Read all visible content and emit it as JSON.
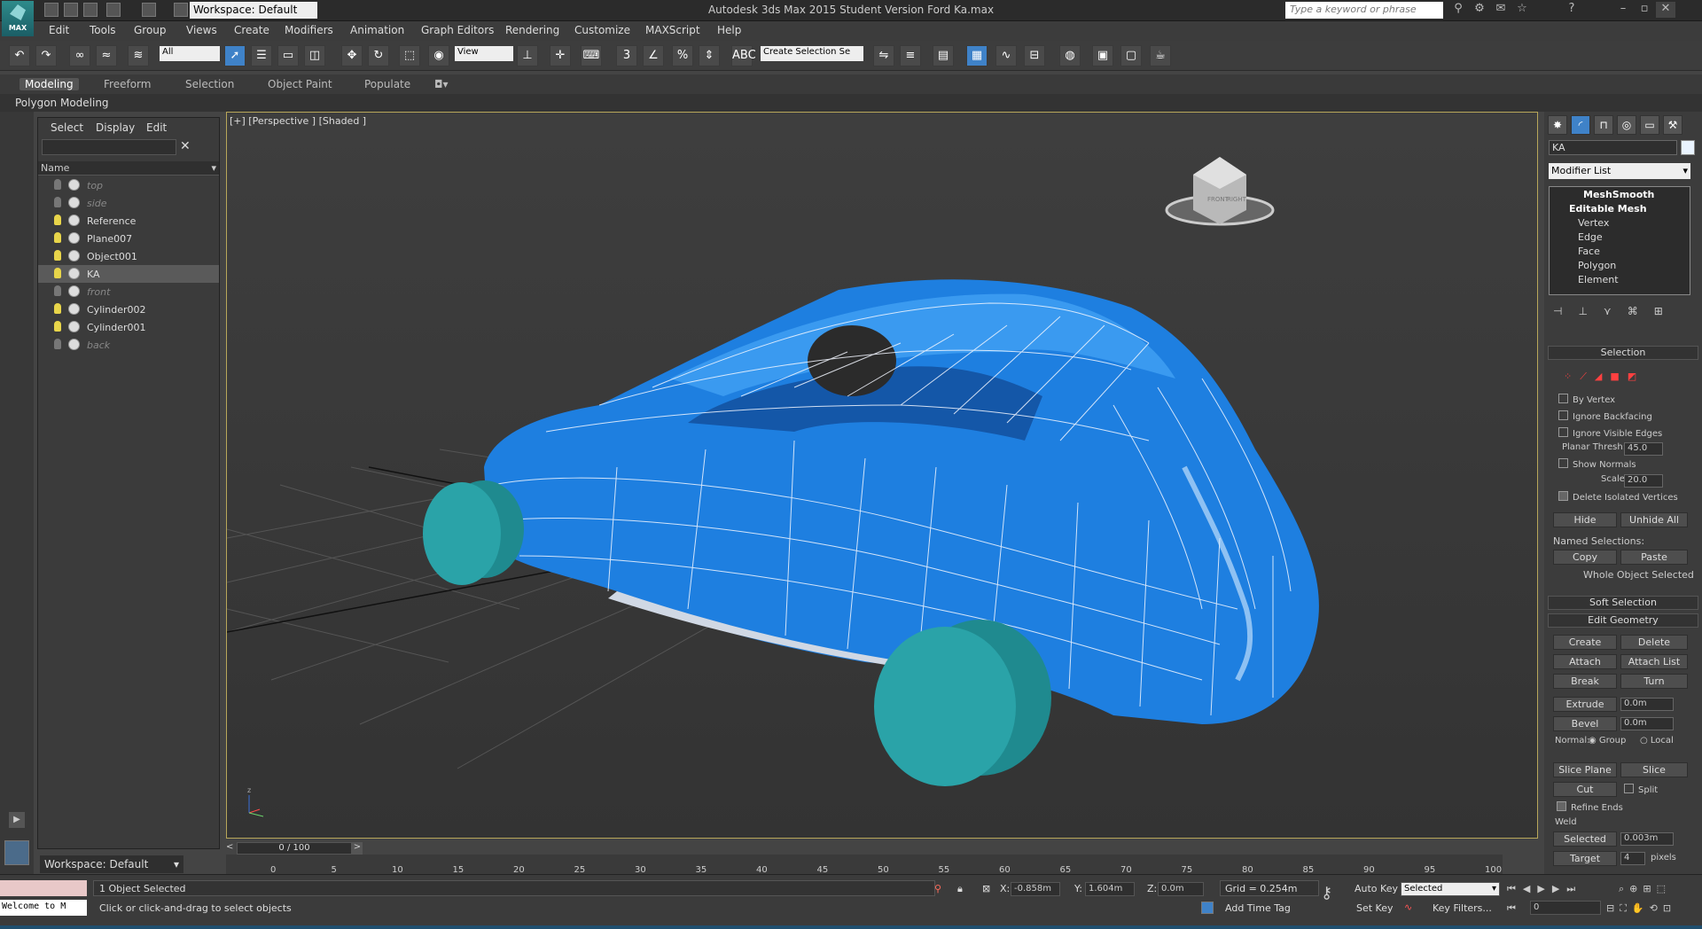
{
  "app": {
    "title": "Autodesk 3ds Max  2015    Student Version    Ford Ka.max",
    "logo_text": "MAX",
    "workspace": "Workspace: Default",
    "search_placeholder": "Type a keyword or phrase"
  },
  "menu": [
    "Edit",
    "Tools",
    "Group",
    "Views",
    "Create",
    "Modifiers",
    "Animation",
    "Graph Editors",
    "Rendering",
    "Customize",
    "MAXScript",
    "Help"
  ],
  "toolbar": {
    "filter": "All",
    "coord": "View",
    "selset": "Create Selection Se",
    "snap_num": "3",
    "angle_num": "%"
  },
  "ribbon": {
    "tabs": [
      "Modeling",
      "Freeform",
      "Selection",
      "Object Paint",
      "Populate"
    ],
    "active": "Modeling",
    "sub": "Polygon Modeling"
  },
  "scene": {
    "tabs": [
      "Select",
      "Display",
      "Edit"
    ],
    "column": "Name",
    "items": [
      {
        "name": "top",
        "hidden": true
      },
      {
        "name": "side",
        "hidden": true
      },
      {
        "name": "Reference",
        "hidden": false
      },
      {
        "name": "Plane007",
        "hidden": false
      },
      {
        "name": "Object001",
        "hidden": false
      },
      {
        "name": "KA",
        "hidden": false,
        "selected": true
      },
      {
        "name": "front",
        "hidden": true
      },
      {
        "name": "Cylinder002",
        "hidden": false
      },
      {
        "name": "Cylinder001",
        "hidden": false
      },
      {
        "name": "back",
        "hidden": true
      }
    ],
    "workspace": "Workspace: Default"
  },
  "viewport": {
    "label": "[+] [Perspective ] [Shaded ]",
    "viewcube_front": "FRONT",
    "viewcube_right": "RIGHT",
    "axis_z": "z",
    "body_color": "#1e7fe0",
    "wheel_color": "#2aa3a8"
  },
  "command": {
    "object_name": "KA",
    "modifier_list": "Modifier List",
    "stack": [
      "MeshSmooth",
      "Editable Mesh",
      "Vertex",
      "Edge",
      "Face",
      "Polygon",
      "Element"
    ],
    "selection": {
      "title": "Selection",
      "by_vertex": "By Vertex",
      "ignore_backfacing": "Ignore Backfacing",
      "ignore_visible": "Ignore Visible Edges",
      "planar_label": "Planar Thresh:",
      "planar_value": "45.0",
      "show_normals": "Show Normals",
      "scale_label": "Scale:",
      "scale_value": "20.0",
      "delete_isolated": "Delete Isolated Vertices",
      "hide": "Hide",
      "unhide": "Unhide All",
      "named_sel": "Named Selections:",
      "copy": "Copy",
      "paste": "Paste",
      "whole": "Whole Object Selected"
    },
    "soft_selection": "Soft Selection",
    "edit_geometry": {
      "title": "Edit Geometry",
      "create": "Create",
      "delete": "Delete",
      "attach": "Attach",
      "attach_list": "Attach List",
      "break": "Break",
      "turn": "Turn",
      "extrude": "Extrude",
      "extrude_val": "0.0m",
      "bevel": "Bevel",
      "bevel_val": "0.0m",
      "normal": "Normal:",
      "group": "Group",
      "local": "Local",
      "slice_plane": "Slice Plane",
      "slice": "Slice",
      "cut": "Cut",
      "split": "Split",
      "refine": "Refine Ends",
      "weld": "Weld",
      "selected": "Selected",
      "selected_val": "0.003m",
      "target": "Target",
      "target_val": "4",
      "pixels": "pixels"
    }
  },
  "timeline": {
    "frame": "0 / 100",
    "ticks": [
      "0",
      "5",
      "10",
      "15",
      "20",
      "25",
      "30",
      "35",
      "40",
      "45",
      "50",
      "55",
      "60",
      "65",
      "70",
      "75",
      "80",
      "85",
      "90",
      "95",
      "100"
    ]
  },
  "status": {
    "welcome": "Welcome to M",
    "selected": "1 Object Selected",
    "prompt": "Click or click-and-drag to select objects",
    "x_label": "X:",
    "x": "-0.858m",
    "y_label": "Y:",
    "y": "1.604m",
    "z_label": "Z:",
    "z": "0.0m",
    "grid": "Grid = 0.254m",
    "add_time_tag": "Add Time Tag",
    "auto_key": "Auto Key",
    "auto_combo": "Selected",
    "set_key": "Set Key",
    "key_filters": "Key Filters...",
    "frame_field": "0"
  }
}
